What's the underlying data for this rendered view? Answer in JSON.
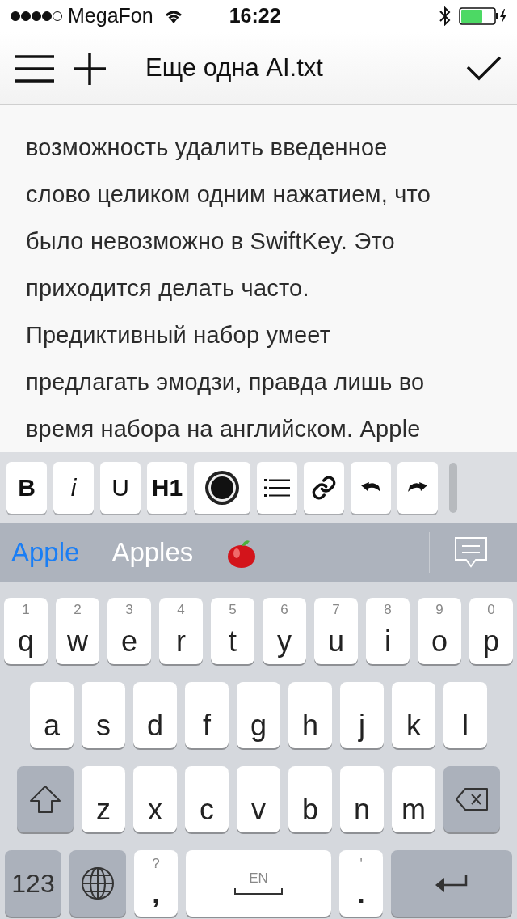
{
  "status_bar": {
    "carrier": "MegaFon",
    "time": "16:22"
  },
  "nav_bar": {
    "title": "Еще одна AI.txt"
  },
  "editor": {
    "lines": [
      "возможность удалить введенное",
      "слово целиком одним нажатием, что",
      "было невозможно в SwiftKey. Это",
      "приходится делать часто.",
      "Предиктивный набор умеет",
      "предлагать эмодзи, правда лишь во",
      "время набора на английском. Apple"
    ]
  },
  "format_toolbar": [
    {
      "kind": "bold",
      "label": "B"
    },
    {
      "kind": "italic",
      "label": "i"
    },
    {
      "kind": "underline",
      "label": "U"
    },
    {
      "kind": "heading",
      "label": "H1"
    },
    {
      "kind": "color"
    },
    {
      "kind": "list"
    },
    {
      "kind": "link"
    },
    {
      "kind": "undo"
    },
    {
      "kind": "redo"
    }
  ],
  "suggestions": [
    {
      "label": "Apple",
      "selected": true
    },
    {
      "label": "Apples",
      "selected": false
    }
  ],
  "keyboard": [
    [
      {
        "kind": "letter",
        "label": "q",
        "hint": "1"
      },
      {
        "kind": "letter",
        "label": "w",
        "hint": "2"
      },
      {
        "kind": "letter",
        "label": "e",
        "hint": "3"
      },
      {
        "kind": "letter",
        "label": "r",
        "hint": "4"
      },
      {
        "kind": "letter",
        "label": "t",
        "hint": "5"
      },
      {
        "kind": "letter",
        "label": "y",
        "hint": "6"
      },
      {
        "kind": "letter",
        "label": "u",
        "hint": "7"
      },
      {
        "kind": "letter",
        "label": "i",
        "hint": "8"
      },
      {
        "kind": "letter",
        "label": "o",
        "hint": "9"
      },
      {
        "kind": "letter",
        "label": "p",
        "hint": "0"
      }
    ],
    [
      {
        "kind": "letter",
        "label": "a"
      },
      {
        "kind": "letter",
        "label": "s"
      },
      {
        "kind": "letter",
        "label": "d"
      },
      {
        "kind": "letter",
        "label": "f"
      },
      {
        "kind": "letter",
        "label": "g"
      },
      {
        "kind": "letter",
        "label": "h"
      },
      {
        "kind": "letter",
        "label": "j"
      },
      {
        "kind": "letter",
        "label": "k"
      },
      {
        "kind": "letter",
        "label": "l"
      }
    ],
    [
      {
        "kind": "shift"
      },
      {
        "kind": "letter",
        "label": "z"
      },
      {
        "kind": "letter",
        "label": "x"
      },
      {
        "kind": "letter",
        "label": "c"
      },
      {
        "kind": "letter",
        "label": "v"
      },
      {
        "kind": "letter",
        "label": "b"
      },
      {
        "kind": "letter",
        "label": "n"
      },
      {
        "kind": "letter",
        "label": "m"
      },
      {
        "kind": "backspace"
      }
    ],
    [
      {
        "kind": "mode",
        "label": "123"
      },
      {
        "kind": "globe"
      },
      {
        "kind": "punct",
        "label": ",",
        "hint": "?"
      },
      {
        "kind": "space",
        "label": "EN"
      },
      {
        "kind": "punct",
        "label": ".",
        "hint": "'"
      },
      {
        "kind": "return"
      }
    ]
  ]
}
